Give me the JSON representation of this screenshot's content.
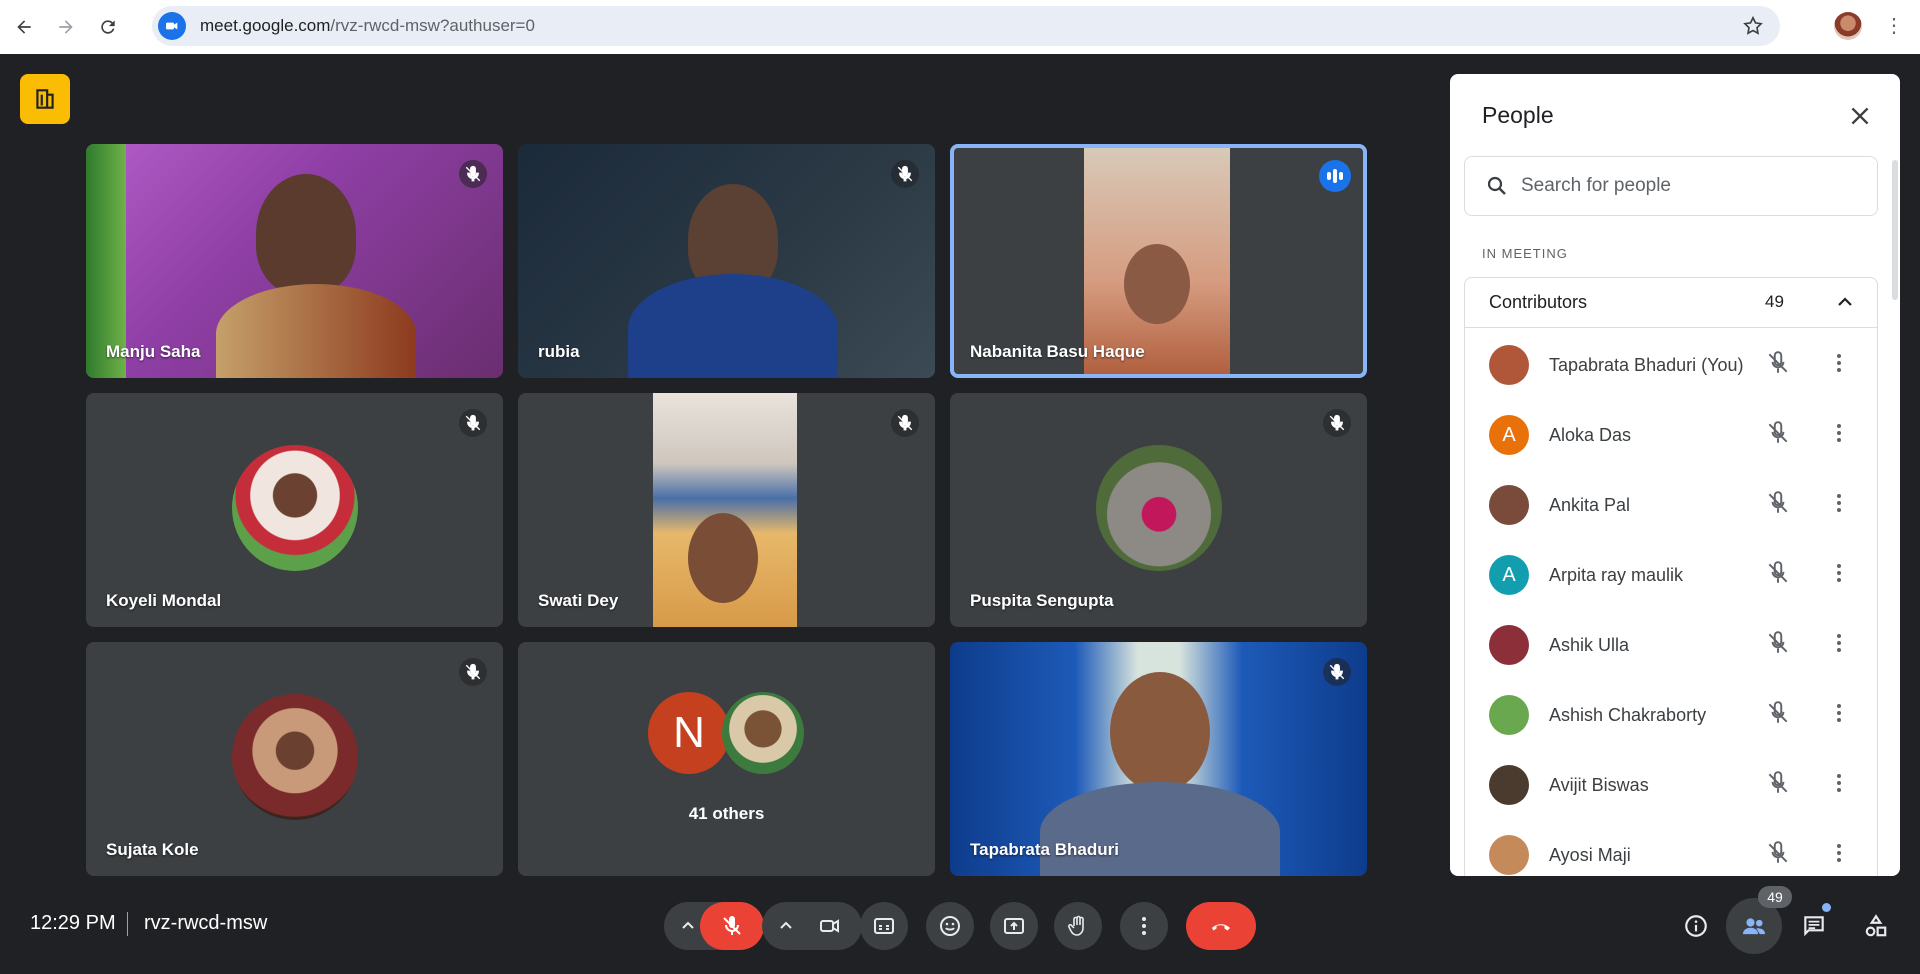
{
  "browser": {
    "url_host": "meet.google.com",
    "url_path": "/rvz-rwcd-msw?authuser=0"
  },
  "tiles": [
    {
      "name": "Manju Saha"
    },
    {
      "name": "rubia"
    },
    {
      "name": "Nabanita Basu Haque"
    },
    {
      "name": "Koyeli Mondal"
    },
    {
      "name": "Swati Dey"
    },
    {
      "name": "Puspita Sengupta"
    },
    {
      "name": "Sujata Kole"
    },
    {
      "name": "41 others",
      "initial": "N"
    },
    {
      "name": "Tapabrata Bhaduri"
    }
  ],
  "bottom": {
    "time": "12:29 PM",
    "meeting_code": "rvz-rwcd-msw",
    "participant_count": "49"
  },
  "panel": {
    "title": "People",
    "search_placeholder": "Search for people",
    "section": "IN MEETING",
    "group_title": "Contributors",
    "group_count": "49",
    "people": [
      {
        "name": "Tapabrata Bhaduri (You)",
        "initial": "",
        "color": "#b0573a"
      },
      {
        "name": "Aloka Das",
        "initial": "A",
        "color": "#e8710a"
      },
      {
        "name": "Ankita Pal",
        "initial": "",
        "color": "#7a4a3a"
      },
      {
        "name": "Arpita ray maulik",
        "initial": "A",
        "color": "#129eaf"
      },
      {
        "name": "Ashik Ulla",
        "initial": "",
        "color": "#8c2f39"
      },
      {
        "name": "Ashish Chakraborty",
        "initial": "",
        "color": "#6aa84f"
      },
      {
        "name": "Avijit Biswas",
        "initial": "",
        "color": "#4a3b2e"
      },
      {
        "name": "Ayosi Maji",
        "initial": "",
        "color": "#c58a5a"
      }
    ]
  }
}
